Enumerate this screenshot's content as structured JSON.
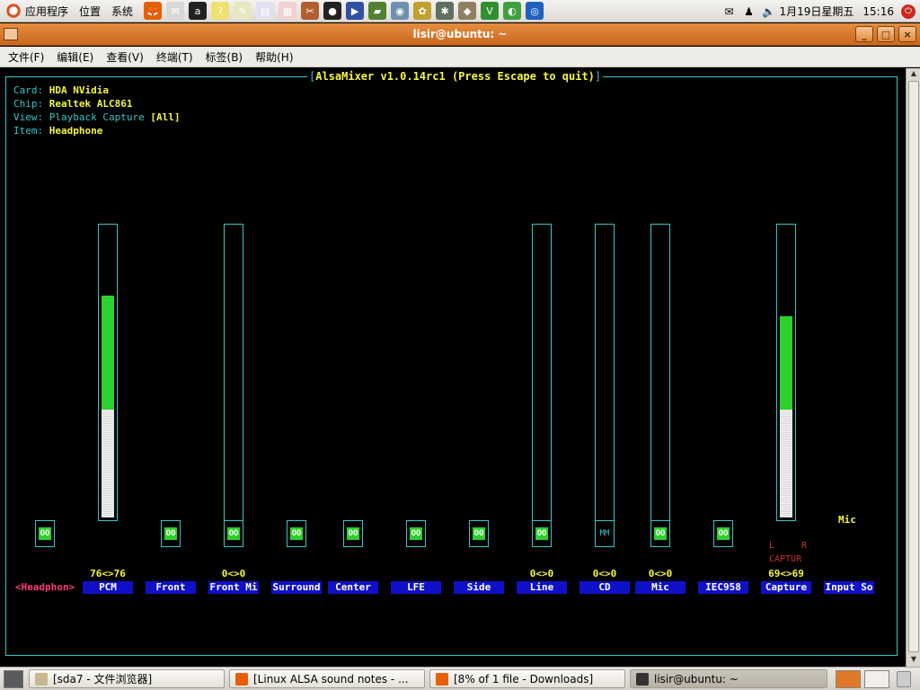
{
  "top_panel": {
    "menus": [
      "应用程序",
      "位置",
      "系统"
    ],
    "launchers": [
      {
        "icon": "firefox-icon",
        "color": "#e66000",
        "glyph": "🦊"
      },
      {
        "icon": "mail-icon",
        "color": "#d8d8d8",
        "glyph": "✉"
      },
      {
        "icon": "amarok-icon",
        "color": "#222222",
        "glyph": "a"
      },
      {
        "icon": "help-icon",
        "color": "#f0e070",
        "glyph": "?"
      },
      {
        "icon": "text-editor-icon",
        "color": "#e8e8c0",
        "glyph": "✎"
      },
      {
        "icon": "document-icon",
        "color": "#e0e0f0",
        "glyph": "▤"
      },
      {
        "icon": "presentation-icon",
        "color": "#f0d0d0",
        "glyph": "▦"
      },
      {
        "icon": "tools-icon",
        "color": "#b06030",
        "glyph": "✂"
      },
      {
        "icon": "qq-icon",
        "color": "#222222",
        "glyph": "●"
      },
      {
        "icon": "mplayer-icon",
        "color": "#3050a0",
        "glyph": "▶"
      },
      {
        "icon": "dictionary-icon",
        "color": "#508030",
        "glyph": "▰"
      },
      {
        "icon": "disk-icon",
        "color": "#7090b0",
        "glyph": "◉"
      },
      {
        "icon": "gimp-icon",
        "color": "#c0a030",
        "glyph": "✿"
      },
      {
        "icon": "settings-icon",
        "color": "#607060",
        "glyph": "✱"
      },
      {
        "icon": "package-icon",
        "color": "#908060",
        "glyph": "◆"
      },
      {
        "icon": "vim-icon",
        "color": "#309030",
        "glyph": "V"
      },
      {
        "icon": "network-icon",
        "color": "#40a040",
        "glyph": "◐"
      },
      {
        "icon": "globe-icon",
        "color": "#2060c0",
        "glyph": "◎"
      }
    ],
    "date": "1月19日星期五",
    "time": "15:16"
  },
  "window": {
    "title": "lisir@ubuntu: ~",
    "menu": [
      "文件(F)",
      "编辑(E)",
      "查看(V)",
      "终端(T)",
      "标签(B)",
      "帮助(H)"
    ]
  },
  "alsamixer": {
    "title": "AlsaMixer v1.0.14rc1 (Press Escape to quit)",
    "card_key": "Card:",
    "card": "HDA NVidia",
    "chip_key": "Chip:",
    "chip": "Realtek ALC861",
    "view_key": "View:",
    "view_playback": "Playback",
    "view_capture": "Capture",
    "view_all": "[All]",
    "item_key": "Item:",
    "item": "Headphone",
    "channels": [
      {
        "label": "<Headphon>",
        "current": true,
        "has_bar": false,
        "mute": "OO"
      },
      {
        "label": "PCM",
        "has_bar": true,
        "level": 76,
        "volume": "76<>76",
        "mute": null
      },
      {
        "label": "Front",
        "has_bar": false,
        "mute": "OO"
      },
      {
        "label": "Front Mi",
        "has_bar": true,
        "level": 0,
        "volume": "0<>0",
        "mute": "OO"
      },
      {
        "label": "Surround",
        "has_bar": false,
        "mute": "OO"
      },
      {
        "label": "Center",
        "has_bar": false,
        "mute": "OO"
      },
      {
        "label": "LFE",
        "has_bar": false,
        "mute": "OO"
      },
      {
        "label": "Side",
        "has_bar": false,
        "mute": "OO"
      },
      {
        "label": "Line",
        "has_bar": true,
        "level": 0,
        "volume": "0<>0",
        "mute": "OO"
      },
      {
        "label": "CD",
        "has_bar": true,
        "level": 0,
        "volume": "0<>0",
        "mute": "MM"
      },
      {
        "label": "Mic",
        "has_bar": true,
        "level": 0,
        "volume": "0<>0",
        "mute": "OO"
      },
      {
        "label": "IEC958",
        "has_bar": false,
        "mute": "OO"
      },
      {
        "label": "Capture",
        "has_bar": true,
        "level": 69,
        "volume": "69<>69",
        "mute": null
      },
      {
        "label": "Input So",
        "has_bar": false,
        "mute": null
      }
    ],
    "capture_left": "L",
    "capture_right": "R",
    "capture_tag": "CAPTUR",
    "input_source_value": "Mic"
  },
  "taskbar": {
    "tasks": [
      {
        "label": "[sda7 - 文件浏览器]",
        "icon": "folder-icon",
        "color": "#c8b890",
        "active": false
      },
      {
        "label": "[Linux ALSA sound notes - ...",
        "icon": "firefox-icon",
        "color": "#e66000",
        "active": false
      },
      {
        "label": "[8% of 1 file - Downloads]",
        "icon": "firefox-icon",
        "color": "#e66000",
        "active": false
      },
      {
        "label": "lisir@ubuntu: ~",
        "icon": "terminal-icon",
        "color": "#333333",
        "active": true
      }
    ]
  },
  "colors": {
    "frame": "#36c6c6",
    "label_text": "#f5f542",
    "channel_bg": "#1010c8",
    "current_channel": "#ff3a7a",
    "level_green": "#2dd02d",
    "title_orange": "#d9782a"
  }
}
